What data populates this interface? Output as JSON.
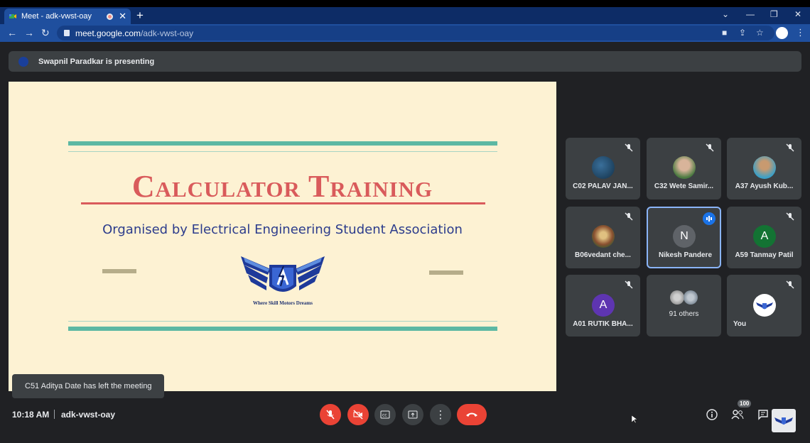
{
  "browser": {
    "tab_title": "Meet - adk-vwst-oay",
    "url_host": "meet.google.com",
    "url_path": "/adk-vwst-oay"
  },
  "presenting": {
    "text": "Swapnil Paradkar is presenting"
  },
  "slide": {
    "title": "Calculator Training",
    "subtitle": "Organised by Electrical Engineering Student Association",
    "tagline": "Where Skill Motors Dreams",
    "colors": {
      "background": "#fdf2d3",
      "accent": "#5cb8a3",
      "title": "#d95b5b",
      "subtitle": "#2c3c8c"
    }
  },
  "toast": {
    "text": "C51 Aditya Date has left the meeting"
  },
  "participants": [
    {
      "name": "C02 PALAV JAN...",
      "avatar": "photo",
      "muted": true
    },
    {
      "name": "C32 Wete Samir...",
      "avatar": "photo",
      "muted": true
    },
    {
      "name": "A37 Ayush Kub...",
      "avatar": "photo",
      "muted": true
    },
    {
      "name": "B06vedant che...",
      "avatar": "photo",
      "muted": true
    },
    {
      "name": "Nikesh Pandere",
      "avatar": "N",
      "speaking": true
    },
    {
      "name": "A59 Tanmay Patil",
      "avatar": "A",
      "muted": true
    },
    {
      "name": "A01 RUTIK BHA...",
      "avatar": "A",
      "muted": true
    },
    {
      "name": "91 others",
      "avatar": "group"
    },
    {
      "name": "You",
      "avatar": "logo",
      "muted": true
    }
  ],
  "bottom_bar": {
    "time": "10:18 AM",
    "meeting_code": "adk-vwst-oay",
    "people_count": "100"
  }
}
